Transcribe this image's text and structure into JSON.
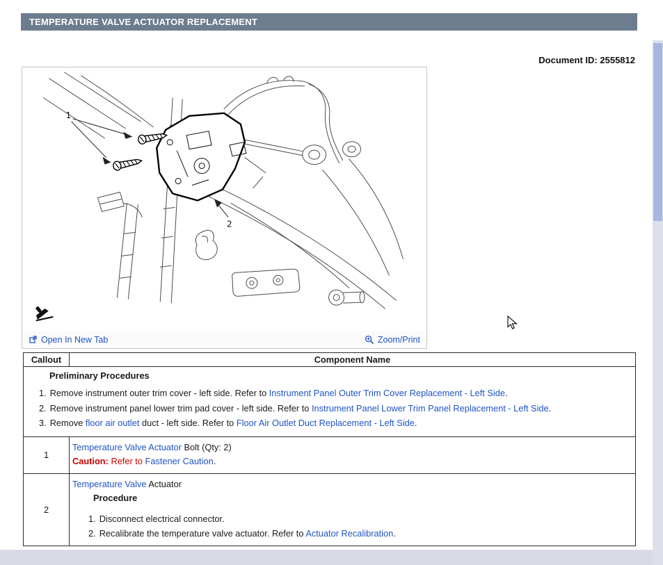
{
  "page": {
    "title": "TEMPERATURE VALVE ACTUATOR REPLACEMENT",
    "document_id": "Document ID: 2555812"
  },
  "colors": {
    "header_bg": "#6d7c8f",
    "link_blue": "#1f53c5",
    "caution_red": "#cc0000"
  },
  "figure": {
    "open_in_new_tab": "Open In New Tab",
    "zoom_print": "Zoom/Print",
    "callouts": [
      "1",
      "2"
    ],
    "icons": [
      "open-in-new-tab-icon",
      "magnifier-plus-icon",
      "stamp-icon"
    ]
  },
  "table": {
    "headers": {
      "callout": "Callout",
      "component": "Component Name"
    },
    "preliminary": {
      "title": "Preliminary Procedures",
      "items": [
        {
          "num": "1.",
          "pre": "Remove instrument outer trim cover - left side. Refer to ",
          "link1": "Instrument Panel Outer Trim Cover Replacement - Left Side",
          "mid": "",
          "link2": "",
          "post": "."
        },
        {
          "num": "2.",
          "pre": "Remove instrument panel lower trim pad cover - left side. Refer to ",
          "link1": "Instrument Panel Lower Trim Panel Replacement - Left Side",
          "mid": "",
          "link2": "",
          "post": "."
        },
        {
          "num": "3.",
          "pre": "Remove ",
          "link1": "floor air outlet",
          "mid": " duct - left side. Refer to ",
          "link2": "Floor Air Outlet Duct Replacement - Left Side",
          "post": "."
        }
      ]
    },
    "rows": [
      {
        "callout": "1",
        "name_link": "Temperature Valve Actuator",
        "name_rest": " Bolt (Qty: 2)",
        "caution_label": "Caution:",
        "caution_mid": " Refer to ",
        "caution_link": "Fastener Caution",
        "caution_post": "."
      },
      {
        "callout": "2",
        "name_link": "Temperature Valve",
        "name_rest": " Actuator",
        "procedure_label": "Procedure",
        "steps": [
          {
            "num": "1.",
            "pre": "Disconnect electrical connector.",
            "link": "",
            "post": ""
          },
          {
            "num": "2.",
            "pre": "Recalibrate the temperature valve actuator. Refer to ",
            "link": "Actuator Recalibration",
            "post": "."
          }
        ]
      }
    ]
  }
}
